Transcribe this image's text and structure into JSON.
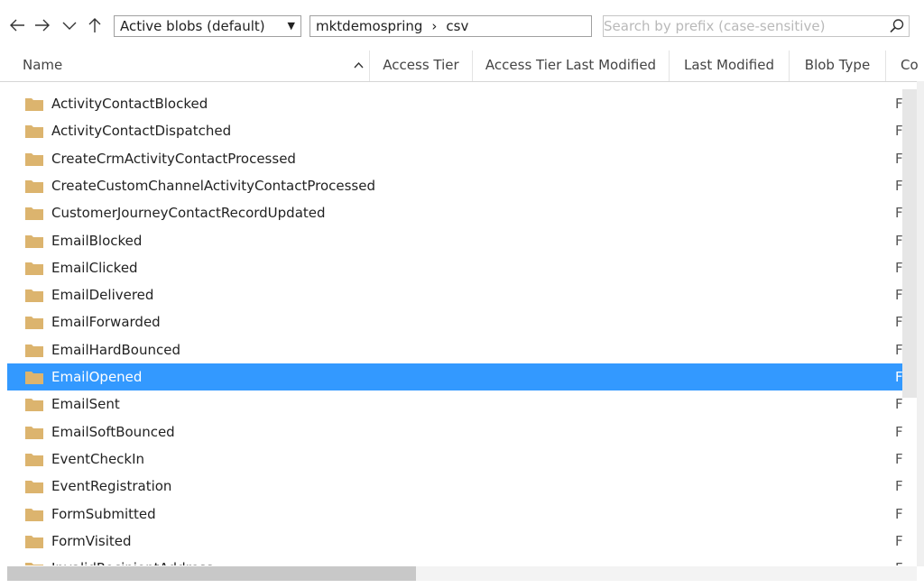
{
  "toolbar": {
    "filter_selected": "Active blobs (default)",
    "breadcrumb": [
      "mktdemospring",
      "csv"
    ],
    "search_placeholder": "Search by prefix (case-sensitive)"
  },
  "columns": {
    "name": "Name",
    "access_tier": "Access Tier",
    "access_tier_last_modified": "Access Tier Last Modified",
    "last_modified": "Last Modified",
    "blob_type": "Blob Type",
    "content_type": "Co"
  },
  "rows": [
    {
      "name": "ActivityContactBlocked",
      "type": "F"
    },
    {
      "name": "ActivityContactDispatched",
      "type": "F"
    },
    {
      "name": "CreateCrmActivityContactProcessed",
      "type": "F"
    },
    {
      "name": "CreateCustomChannelActivityContactProcessed",
      "type": "F"
    },
    {
      "name": "CustomerJourneyContactRecordUpdated",
      "type": "F"
    },
    {
      "name": "EmailBlocked",
      "type": "F"
    },
    {
      "name": "EmailClicked",
      "type": "F"
    },
    {
      "name": "EmailDelivered",
      "type": "F"
    },
    {
      "name": "EmailForwarded",
      "type": "F"
    },
    {
      "name": "EmailHardBounced",
      "type": "F"
    },
    {
      "name": "EmailOpened",
      "type": "F"
    },
    {
      "name": "EmailSent",
      "type": "F"
    },
    {
      "name": "EmailSoftBounced",
      "type": "F"
    },
    {
      "name": "EventCheckIn",
      "type": "F"
    },
    {
      "name": "EventRegistration",
      "type": "F"
    },
    {
      "name": "FormSubmitted",
      "type": "F"
    },
    {
      "name": "FormVisited",
      "type": "F"
    },
    {
      "name": "InvalidRecipientAddress",
      "type": "F"
    }
  ],
  "selected_row": "EmailOpened",
  "colors": {
    "selection": "#3399ff",
    "folder": "#dcb46e"
  }
}
